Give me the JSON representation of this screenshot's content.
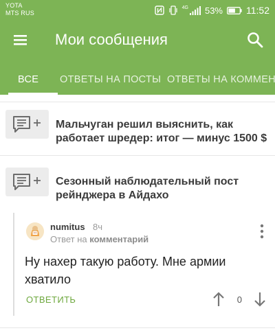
{
  "status_bar": {
    "carrier_1": "YOTA",
    "carrier_2": "MTS RUS",
    "network": "4G",
    "battery": "53%",
    "time": "11:52"
  },
  "app_bar": {
    "title": "Мои сообщения",
    "menu_icon": "hamburger-menu-icon",
    "search_icon": "search-icon"
  },
  "tabs": [
    {
      "label": "ВСЕ",
      "active": true
    },
    {
      "label": "ОТВЕТЫ НА ПОСТЫ",
      "active": false
    },
    {
      "label": "ОТВЕТЫ НА КОММЕНТАРИИ",
      "active": false
    }
  ],
  "posts": [
    {
      "title": "Мальчуган решил выяснить, как работает шредер: итог — минус 1500 $",
      "icon": "comment-plus-icon"
    },
    {
      "title": "Сезонный наблюдательный пост рейнджера в Айдахо",
      "icon": "comment-plus-icon"
    }
  ],
  "comment": {
    "author": "numitus",
    "time": "8ч",
    "reply_prefix": "Ответ на",
    "reply_target": "комментарий",
    "text": "Ну нахер такую работу. Мне армии хватило",
    "reply_label": "ОТВЕТИТЬ",
    "rating": "0"
  },
  "colors": {
    "brand_green": "#7db455",
    "accent_green": "#6ea83e"
  }
}
